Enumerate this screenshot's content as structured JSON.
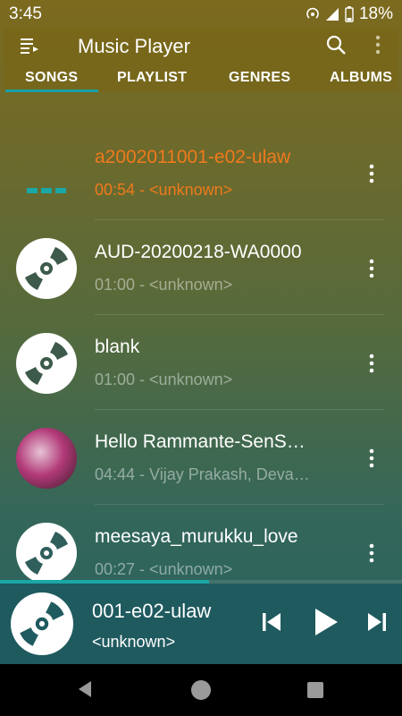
{
  "status": {
    "time": "3:45",
    "battery": "18%"
  },
  "header": {
    "title": "Music Player"
  },
  "tabs": [
    {
      "label": "SONGS",
      "selected": true
    },
    {
      "label": "PLAYLIST"
    },
    {
      "label": "GENRES"
    },
    {
      "label": "ALBUMS"
    }
  ],
  "songs": [
    {
      "title": "a2002011001-e02-ulaw",
      "subtitle": "00:54 - <unknown>",
      "playing": true
    },
    {
      "title": "AUD-20200218-WA0000",
      "subtitle": "01:00 - <unknown>"
    },
    {
      "title": "blank",
      "subtitle": "01:00 - <unknown>"
    },
    {
      "title": "Hello Rammante-SenS…",
      "subtitle": "04:44 - Vijay Prakash, Deva…"
    },
    {
      "title": "meesaya_murukku_love",
      "subtitle": "00:27 - <unknown>"
    }
  ],
  "now_playing": {
    "title": "001-e02-ulaw",
    "artist": "<unknown>",
    "progress": 0.52
  },
  "colors": {
    "accent": "#ef7a1c",
    "teal": "#1aa7a6"
  },
  "icons": {
    "menu": "playlist-menu-icon",
    "search": "search-icon",
    "more": "more-vert-icon"
  }
}
